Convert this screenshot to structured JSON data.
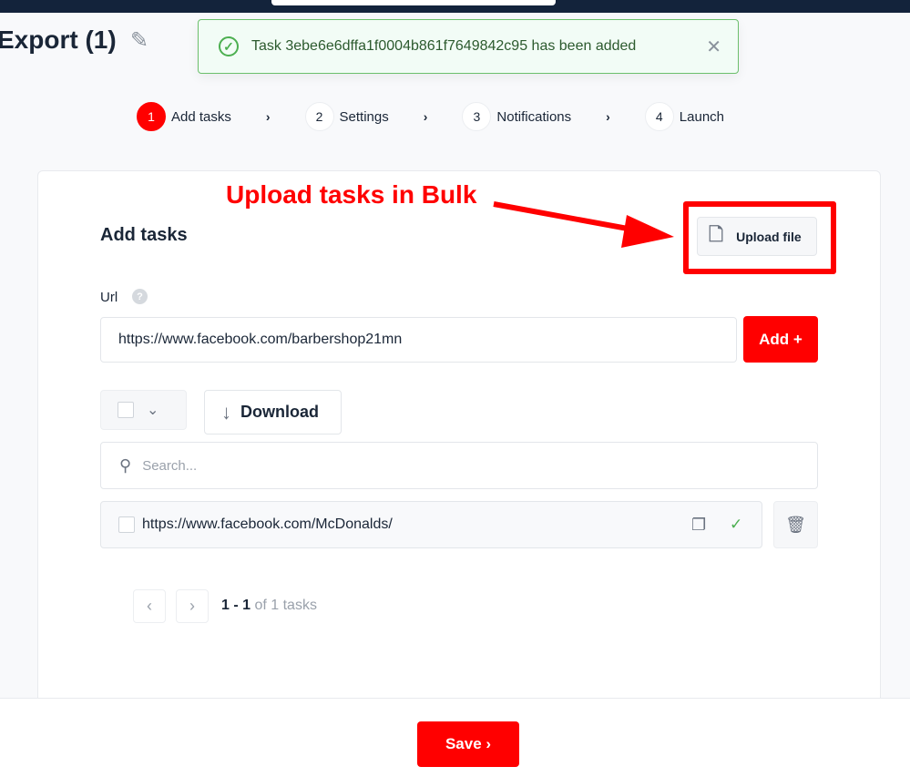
{
  "header": {
    "title": "Export (1)",
    "edit_icon": "pencil-icon"
  },
  "toast": {
    "message": "Task 3ebe6e6dffa1f0004b861f7649842c95 has been added",
    "icon": "check-circle-icon",
    "close_icon": "close-icon",
    "color": "#4caf50"
  },
  "steps": [
    {
      "num": "1",
      "label": "Add tasks",
      "active": true
    },
    {
      "num": "2",
      "label": "Settings"
    },
    {
      "num": "3",
      "label": "Notifications"
    },
    {
      "num": "4",
      "label": "Launch"
    }
  ],
  "annotation": {
    "text": "Upload tasks in Bulk",
    "color": "#ff0000"
  },
  "card": {
    "title": "Add tasks",
    "upload_label": "Upload file",
    "url_label": "Url",
    "help_icon": "?",
    "url_value": "https://www.facebook.com/barbershop21mn",
    "add_label": "Add +",
    "download_label": "Download",
    "search_placeholder": "Search...",
    "tasks": [
      {
        "url": "https://www.facebook.com/McDonalds/",
        "status": "done"
      }
    ],
    "pagination": {
      "range": "1 - 1",
      "total": "of 1 tasks"
    }
  },
  "footer": {
    "save_label": "Save ›"
  },
  "accent": "#ff0000"
}
